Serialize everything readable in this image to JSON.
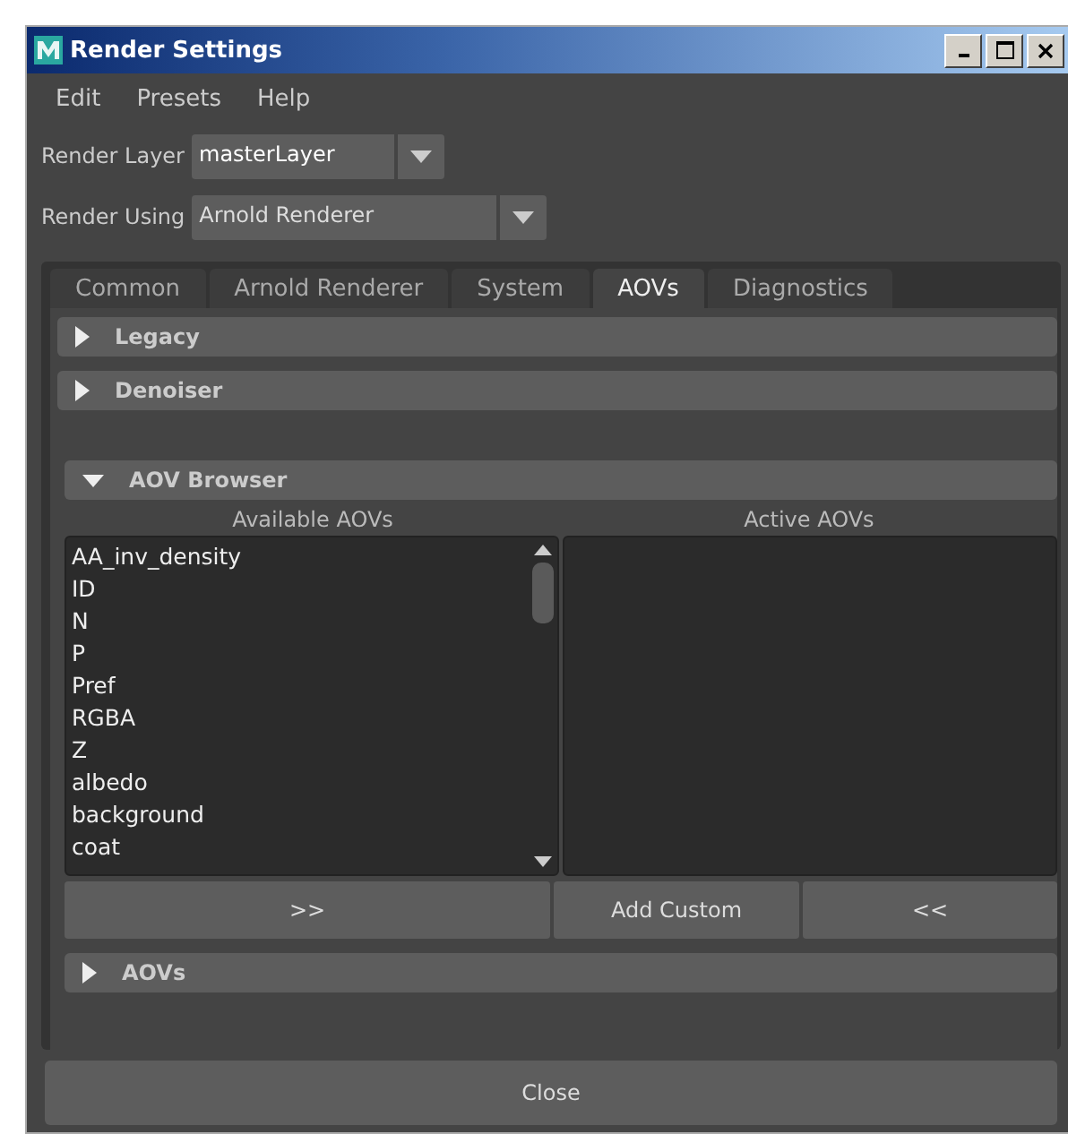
{
  "window": {
    "title": "Render Settings"
  },
  "menu": [
    "Edit",
    "Presets",
    "Help"
  ],
  "render_layer": {
    "label": "Render Layer",
    "value": "masterLayer"
  },
  "render_using": {
    "label": "Render Using",
    "value": "Arnold Renderer"
  },
  "tabs": [
    {
      "label": "Common",
      "selected": false
    },
    {
      "label": "Arnold Renderer",
      "selected": false
    },
    {
      "label": "System",
      "selected": false
    },
    {
      "label": "AOVs",
      "selected": true
    },
    {
      "label": "Diagnostics",
      "selected": false
    }
  ],
  "sections_top": [
    {
      "label": "Legacy",
      "expanded": false
    },
    {
      "label": "Denoiser",
      "expanded": false
    }
  ],
  "aov_browser": {
    "label": "AOV Browser",
    "expanded": true,
    "available_label": "Available AOVs",
    "active_label": "Active AOVs",
    "available": [
      "AA_inv_density",
      "ID",
      "N",
      "P",
      "Pref",
      "RGBA",
      "Z",
      "albedo",
      "background",
      "coat"
    ],
    "buttons": [
      ">>",
      "Add Custom",
      "<<"
    ]
  },
  "sections_bottom": [
    {
      "label": "AOVs",
      "expanded": false
    }
  ],
  "close_button": "Close"
}
